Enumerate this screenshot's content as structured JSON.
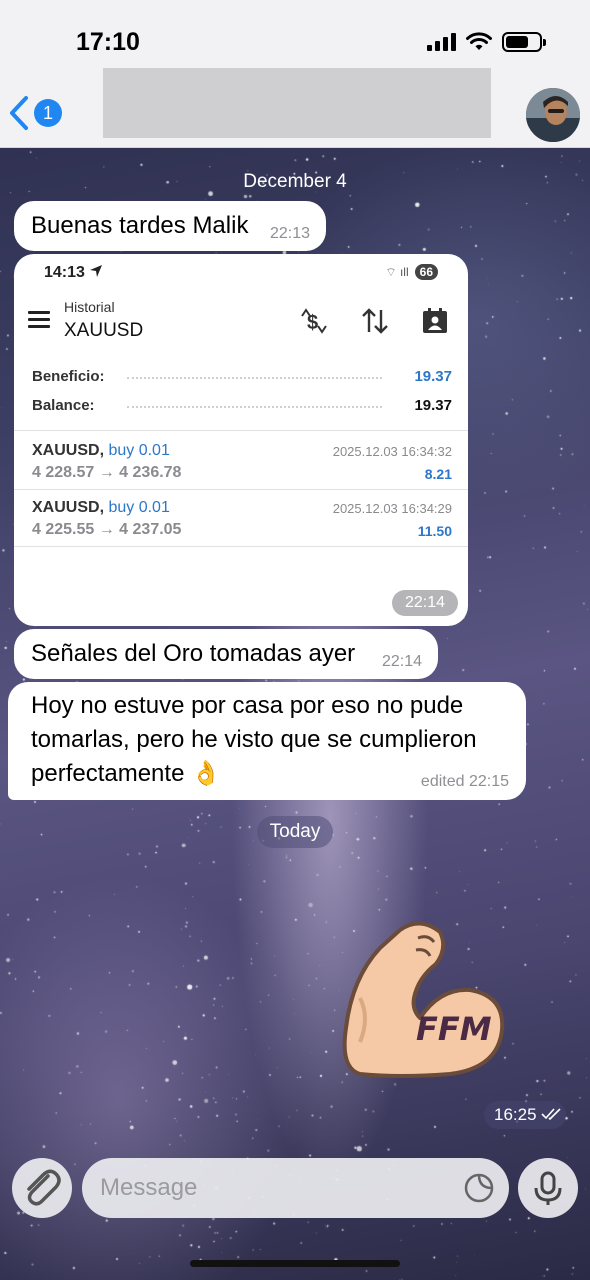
{
  "status_bar": {
    "time": "17:10"
  },
  "header": {
    "back_badge": "1"
  },
  "chat": {
    "date_label": "December 4",
    "messages": [
      {
        "text": "Buenas tardes Malik",
        "time": "22:13"
      },
      {
        "text": "Señales del Oro tomadas ayer",
        "time": "22:14"
      },
      {
        "text": "Hoy no estuve por casa por eso no pude tomarlas, pero he visto que se cumplieron perfectamente 👌",
        "time": "edited 22:15"
      }
    ],
    "image_time": "22:14",
    "today_label": "Today",
    "sticker_text": "FFM",
    "sent_time": "16:25"
  },
  "screenshot": {
    "status_time": "14:13",
    "battery": "66",
    "header_label": "Historial",
    "symbol": "XAUUSD",
    "beneficio_label": "Beneficio:",
    "beneficio_value": "19.37",
    "balance_label": "Balance:",
    "balance_value": "19.37",
    "deals": [
      {
        "symbol": "XAUUSD,",
        "side": "buy 0.01",
        "prices": "4 228.57 → 4 236.78",
        "datetime": "2025.12.03 16:34:32",
        "profit": "8.21"
      },
      {
        "symbol": "XAUUSD,",
        "side": "buy 0.01",
        "prices": "4 225.55 → 4 237.05",
        "datetime": "2025.12.03 16:34:29",
        "profit": "11.50"
      }
    ]
  },
  "input": {
    "placeholder": "Message"
  },
  "colors": {
    "accent": "#1f86f2",
    "profit_blue": "#2d77c8"
  },
  "icons": [
    "back-chevron-icon",
    "paperclip-icon",
    "sticker-icon",
    "microphone-icon",
    "double-check-icon"
  ]
}
